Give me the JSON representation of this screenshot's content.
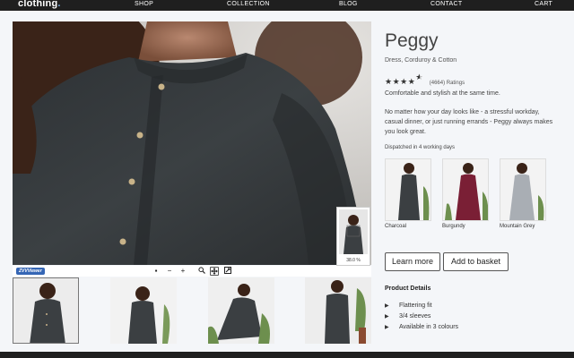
{
  "nav": {
    "logo": "clothing",
    "logo_dot": ".",
    "links": [
      "SHOP",
      "COLLECTION",
      "BLOG",
      "CONTACT",
      "CART"
    ]
  },
  "viewer": {
    "logo_label": "ZVVViewer",
    "zoom_percent": "38.0 %",
    "toolbar_icons": [
      "fit-icon",
      "zoom-out-icon",
      "zoom-in-icon",
      "magnifier-icon",
      "pan-icon",
      "fullscreen-icon"
    ]
  },
  "product": {
    "name": "Peggy",
    "subtitle": "Dress, Corduroy & Cotton",
    "rating_value": 4.5,
    "rating_count": "(4664) Ratings",
    "short_description": "Comfortable and stylish at the same time.",
    "long_description": "No matter how your day looks like - a stressful workday, casual dinner, or just running errands - Peggy always makes you look great.",
    "dispatch": "Dispatched in 4 working days",
    "colours": [
      {
        "label": "Charcoal",
        "hex": "#3b3f42"
      },
      {
        "label": "Burgundy",
        "hex": "#7a1f35"
      },
      {
        "label": "Mountain Grey",
        "hex": "#a9aeb4"
      }
    ],
    "buttons": {
      "learn_more": "Learn more",
      "add_to_basket": "Add to basket"
    },
    "details_title": "Product Details",
    "details": [
      "Flattering fit",
      "3/4 sleeves",
      "Available in 3 colours"
    ]
  },
  "colors": {
    "nav_bg": "#1f1f1f",
    "page_bg": "#f4f6f9",
    "dress": "#3b3f42"
  }
}
